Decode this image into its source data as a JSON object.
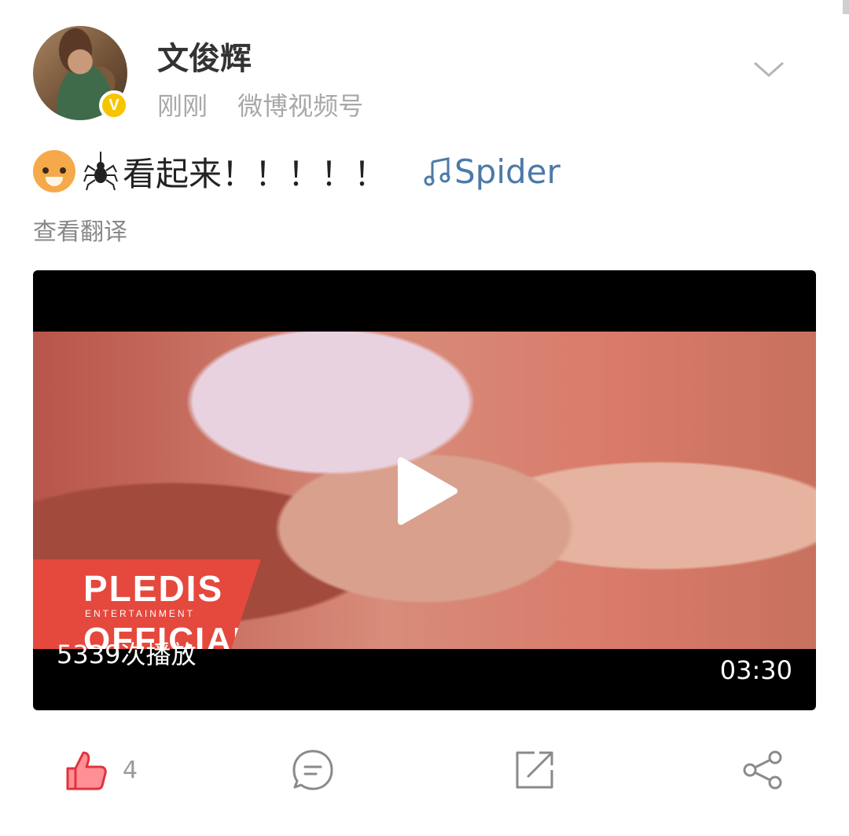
{
  "post": {
    "author": {
      "name": "文俊辉",
      "verified": true,
      "verify_color": "#f7c400",
      "verify_glyph": "V"
    },
    "time": "刚刚",
    "source": "微博视频号",
    "text_emoji": [
      "tiger-face",
      "spider"
    ],
    "text": "看起来！！！！！",
    "music_link": "Spider",
    "link_color": "#4b7aa8",
    "translate_label": "查看翻译"
  },
  "video": {
    "logo_main": "PLEDIS",
    "logo_sub": "ENTERTAINMENT",
    "logo_official": "OFFICIAL",
    "play_count": "5339次播放",
    "duration": "03:30"
  },
  "actions": {
    "like_count": "4",
    "like_color": "#f0505a",
    "icons": [
      "thumbs-up-icon",
      "comment-icon",
      "repost-icon",
      "share-icon"
    ]
  }
}
